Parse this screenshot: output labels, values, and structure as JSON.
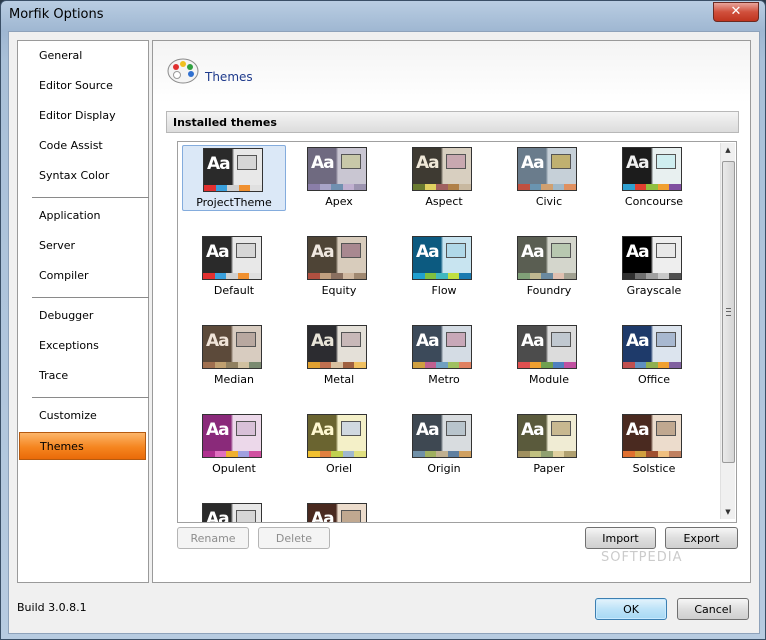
{
  "window": {
    "title": "Morfik Options",
    "close_glyph": "✕"
  },
  "sidebar": {
    "groups": [
      [
        "General",
        "Editor Source",
        "Editor Display",
        "Code Assist",
        "Syntax Color"
      ],
      [
        "Application",
        "Server",
        "Compiler"
      ],
      [
        "Debugger",
        "Exceptions",
        "Trace"
      ],
      [
        "Customize",
        "Themes"
      ]
    ],
    "active": "Themes"
  },
  "page": {
    "title": "Themes",
    "icon": "palette-icon"
  },
  "installed_themes": {
    "header": "Installed themes",
    "selected": "ProjectTheme",
    "themes": [
      {
        "name": "ProjectTheme",
        "bg": [
          "#2a2a2a",
          "#e8e8e8"
        ],
        "aa": "#ffffff",
        "box": "#d6d6d6",
        "stripes": [
          "#e23030",
          "#3aa0dc",
          "#d0d0d0",
          "#f09030",
          "#e0e0e0"
        ]
      },
      {
        "name": "Apex",
        "bg": [
          "#6f6a80",
          "#c9c6d2"
        ],
        "aa": "#ffffff",
        "box": "#c8c8a8",
        "stripes": [
          "#8a7ea8",
          "#a8a4c8",
          "#7090b0",
          "#c0b0d0",
          "#9c94b0"
        ]
      },
      {
        "name": "Aspect",
        "bg": [
          "#3e3a32",
          "#d8cfc0"
        ],
        "aa": "#f0e8d8",
        "box": "#c8a8b0",
        "stripes": [
          "#6a7a30",
          "#e0d060",
          "#a06060",
          "#b08048",
          "#c8b8a0"
        ]
      },
      {
        "name": "Civic",
        "bg": [
          "#6a7c8c",
          "#c6d0d8"
        ],
        "aa": "#ffffff",
        "box": "#c0b070",
        "stripes": [
          "#c05040",
          "#6a94b0",
          "#d0a070",
          "#a0b8c8",
          "#e09060"
        ]
      },
      {
        "name": "Concourse",
        "bg": [
          "#1c1c1c",
          "#e8f0f0"
        ],
        "aa": "#f0f0f0",
        "box": "#cfeef0",
        "stripes": [
          "#30a0d0",
          "#e04030",
          "#90c040",
          "#f0a030",
          "#8050a0"
        ]
      },
      {
        "name": "Default",
        "bg": [
          "#2a2a2a",
          "#e8e8e8"
        ],
        "aa": "#ffffff",
        "box": "#d6d6d6",
        "stripes": [
          "#e23030",
          "#3aa0dc",
          "#d0d0d0",
          "#f09030",
          "#e0e0e0"
        ]
      },
      {
        "name": "Equity",
        "bg": [
          "#4e4436",
          "#d8ccbc"
        ],
        "aa": "#f0e8e0",
        "box": "#a88890",
        "stripes": [
          "#b05040",
          "#c0a080",
          "#8a7060",
          "#d0b8a0",
          "#a08870"
        ]
      },
      {
        "name": "Flow",
        "bg": [
          "#0c5a80",
          "#c8e4f0"
        ],
        "aa": "#ffffff",
        "box": "#b0d8e8",
        "stripes": [
          "#20a0d0",
          "#80c040",
          "#40b8c0",
          "#c0e040",
          "#1a7ab0"
        ]
      },
      {
        "name": "Foundry",
        "bg": [
          "#5a5e52",
          "#d4d6cc"
        ],
        "aa": "#ffffff",
        "box": "#b8c8b0",
        "stripes": [
          "#80a078",
          "#c0b890",
          "#6a8aa0",
          "#e0c0b0",
          "#a0a090"
        ]
      },
      {
        "name": "Grayscale",
        "bg": [
          "#000000",
          "#eeeeee"
        ],
        "aa": "#ffffff",
        "box": "#e8e8e8",
        "stripes": [
          "#303030",
          "#707070",
          "#a0a0a0",
          "#c8c8c8",
          "#505050"
        ]
      },
      {
        "name": "Median",
        "bg": [
          "#5c4a3a",
          "#d8ccc0"
        ],
        "aa": "#f0e4d8",
        "box": "#b8a8a0",
        "stripes": [
          "#a07050",
          "#c0a070",
          "#908060",
          "#d0c0a0",
          "#7a8a70"
        ]
      },
      {
        "name": "Metal",
        "bg": [
          "#2c2c30",
          "#e4e0d8"
        ],
        "aa": "#e8e4d8",
        "box": "#c8b8b8",
        "stripes": [
          "#e0a030",
          "#c07050",
          "#d8c0a0",
          "#a06040",
          "#f0c060"
        ]
      },
      {
        "name": "Metro",
        "bg": [
          "#3c4a5a",
          "#d4dce4"
        ],
        "aa": "#ffffff",
        "box": "#c8a8b8",
        "stripes": [
          "#d0a040",
          "#c06090",
          "#70a0c0",
          "#a0c060",
          "#e08060"
        ]
      },
      {
        "name": "Module",
        "bg": [
          "#4c4c4c",
          "#dcdcdc"
        ],
        "aa": "#ffffff",
        "box": "#c0c8d0",
        "stripes": [
          "#e05050",
          "#f0a030",
          "#70a050",
          "#5080c0",
          "#c050a0"
        ]
      },
      {
        "name": "Office",
        "bg": [
          "#1e3a6a",
          "#dce4ee"
        ],
        "aa": "#ffffff",
        "box": "#a8b8d0",
        "stripes": [
          "#c05050",
          "#6090c0",
          "#90b050",
          "#f0a030",
          "#8060a0"
        ]
      },
      {
        "name": "Opulent",
        "bg": [
          "#8a2a7a",
          "#ecd8ea"
        ],
        "aa": "#ffffff",
        "box": "#d8c0d8",
        "stripes": [
          "#b03090",
          "#e070c0",
          "#f0b030",
          "#a0a0e0",
          "#d050a0"
        ]
      },
      {
        "name": "Oriel",
        "bg": [
          "#6a6430",
          "#f4f0c8"
        ],
        "aa": "#fff8d0",
        "box": "#d0d8e0",
        "stripes": [
          "#f0c030",
          "#e08040",
          "#c0d050",
          "#a0b8d0",
          "#e0e080"
        ]
      },
      {
        "name": "Origin",
        "bg": [
          "#3e4852",
          "#d8dcdf"
        ],
        "aa": "#ffffff",
        "box": "#b8c4cc",
        "stripes": [
          "#7090a8",
          "#a0b060",
          "#c0b090",
          "#6080a0",
          "#d0a060"
        ]
      },
      {
        "name": "Paper",
        "bg": [
          "#5a5a3c",
          "#f0ecd4"
        ],
        "aa": "#ffffff",
        "box": "#c8b890",
        "stripes": [
          "#a09060",
          "#c0c080",
          "#90a070",
          "#e0d0a0",
          "#b0a070"
        ]
      },
      {
        "name": "Solstice",
        "bg": [
          "#4a2a20",
          "#ecdccc"
        ],
        "aa": "#ffffff",
        "box": "#c0a890",
        "stripes": [
          "#e07030",
          "#d0a040",
          "#a05030",
          "#f0c080",
          "#c08060"
        ]
      },
      {
        "name": "",
        "bg": [
          "#2a2a2a",
          "#e8e8e8"
        ],
        "aa": "#ffffff",
        "box": "#d6d6d6",
        "stripes": [
          "#e23030",
          "#3aa0dc",
          "#d0d0d0",
          "#f09030",
          "#e0e0e0"
        ]
      },
      {
        "name": "",
        "bg": [
          "#4a2a20",
          "#ecdccc"
        ],
        "aa": "#ffffff",
        "box": "#c0a890",
        "stripes": [
          "#e07030",
          "#d0a040",
          "#a05030",
          "#f0c080",
          "#c08060"
        ]
      }
    ]
  },
  "buttons": {
    "rename": "Rename",
    "delete": "Delete",
    "import": "Import",
    "export": "Export",
    "ok": "OK",
    "cancel": "Cancel"
  },
  "build": "Build 3.0.8.1",
  "watermark": "SOFTPEDIA"
}
